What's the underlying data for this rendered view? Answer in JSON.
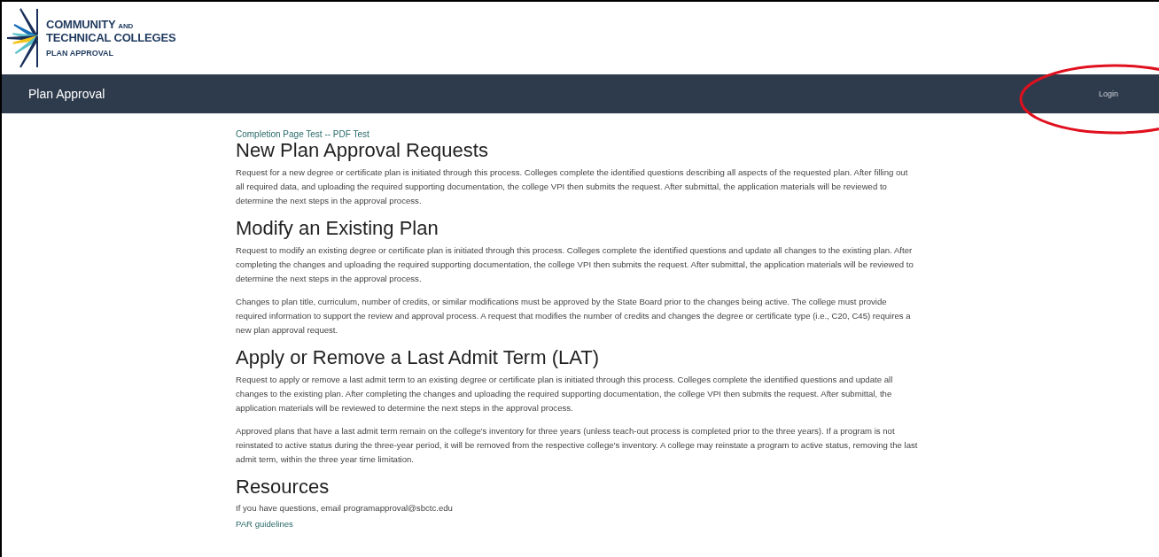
{
  "logo": {
    "line1": "COMMUNITY",
    "line1_small": "AND",
    "line2": "TECHNICAL COLLEGES",
    "subtitle": "PLAN APPROVAL"
  },
  "navbar": {
    "title": "Plan Approval",
    "login": "Login"
  },
  "breadcrumb": "Completion Page Test -- PDF Test",
  "sections": [
    {
      "heading": "New Plan Approval Requests",
      "paragraphs": [
        "Request for a new degree or certificate plan is initiated through this process. Colleges complete the identified questions describing all aspects of the requested plan. After filling out all required data, and uploading the required supporting documentation, the college VPI then submits the request. After submittal, the application materials will be reviewed to determine the next steps in the approval process."
      ]
    },
    {
      "heading": "Modify an Existing Plan",
      "paragraphs": [
        "Request to modify an existing degree or certificate plan is initiated through this process. Colleges complete the identified questions and update all changes to the existing plan. After completing the changes and uploading the required supporting documentation, the college VPI then submits the request. After submittal, the application materials will be reviewed to determine the next steps in the approval process.",
        "Changes to plan title, curriculum, number of credits, or similar modifications must be approved by the State Board prior to the changes being active. The college must provide required information to support the review and approval process. A request that modifies the number of credits and changes the degree or certificate type (i.e., C20, C45) requires a new plan approval request."
      ]
    },
    {
      "heading": "Apply or Remove a Last Admit Term (LAT)",
      "paragraphs": [
        "Request to apply or remove a last admit term to an existing degree or certificate plan is initiated through this process. Colleges complete the identified questions and update all changes to the existing plan. After completing the changes and uploading the required supporting documentation, the college VPI then submits the request. After submittal, the application materials will be reviewed to determine the next steps in the approval process.",
        "Approved plans that have a last admit term remain on the college's inventory for three years (unless teach-out process is completed prior to the three years). If a program is not reinstated to active status during the three-year period, it will be removed from the respective college's inventory. A college may reinstate a program to active status, removing the last admit term, within the three year time limitation."
      ]
    }
  ],
  "resources": {
    "heading": "Resources",
    "text": "If you have questions, email programapproval@sbctc.edu",
    "link": "PAR guidelines"
  }
}
